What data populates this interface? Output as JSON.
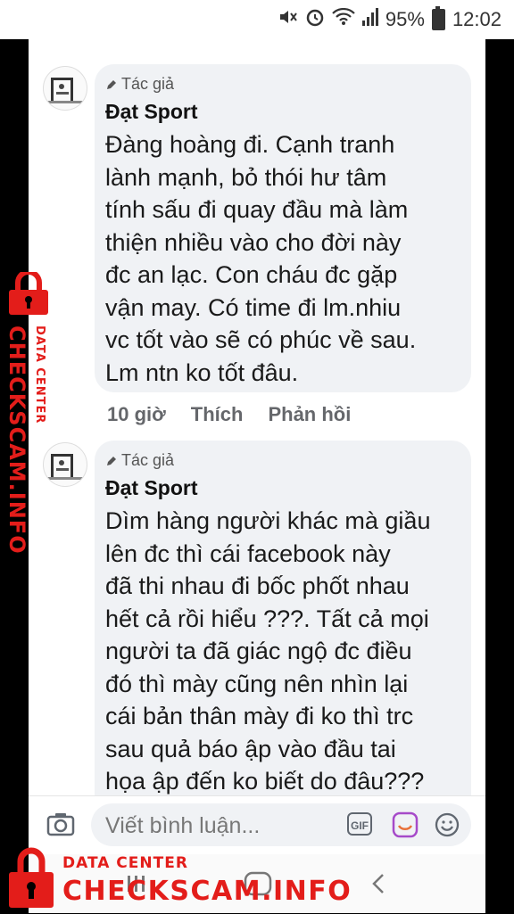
{
  "status_bar": {
    "battery": "95%",
    "time": "12:02"
  },
  "comments": [
    {
      "badge": "Tác giả",
      "author": "Đạt Sport",
      "lines": [
        "Đàng hoàng đi. Cạnh tranh",
        "lành mạnh, bỏ thói hư tâm",
        "tính sấu đi quay đầu mà làm",
        "thiện nhiều vào cho đời này",
        "đc an lạc. Con cháu đc gặp",
        "vận may. Có time đi lm.nhiu",
        "vc tốt vào sẽ có phúc về sau.",
        "Lm ntn ko tốt đâu."
      ],
      "time": "10 giờ",
      "like": "Thích",
      "reply": "Phản hồi"
    },
    {
      "badge": "Tác giả",
      "author": "Đạt Sport",
      "lines": [
        "Dìm hàng người khác mà giầu",
        "lên đc thì cái facebook này",
        "đã thi nhau đi bốc phốt nhau",
        "hết cả rồi hiểu ???. Tất cả mọi",
        "người ta đã giác ngộ đc điều",
        "đó thì mày cũng nên nhìn lại",
        "cái bản thân mày đi ko thì trc",
        "sau quả báo ập vào đầu  tai",
        "họa ập đến ko biết do đâu???"
      ]
    }
  ],
  "composer": {
    "placeholder": "Viết bình luận...",
    "gif_label": "GIF"
  },
  "watermark": {
    "label": "DATA CENTER",
    "name": "CHECKSCAM.INFO",
    "color": "#e31d1a"
  }
}
